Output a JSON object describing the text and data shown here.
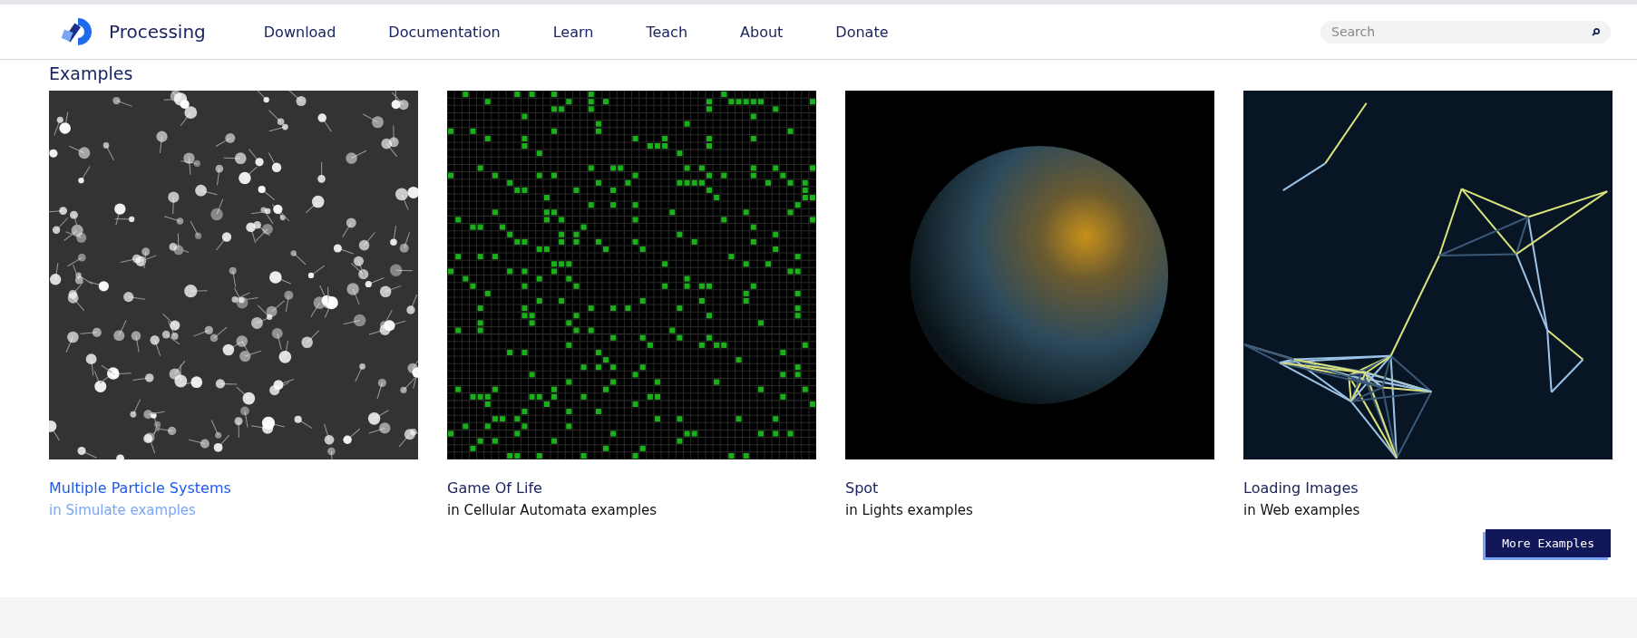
{
  "header": {
    "brand": "Processing",
    "nav": [
      "Download",
      "Documentation",
      "Learn",
      "Teach",
      "About",
      "Donate"
    ],
    "search": {
      "placeholder": "Search"
    }
  },
  "section": {
    "heading": "Examples"
  },
  "examples": [
    {
      "kind": "particles",
      "title": "Multiple Particle Systems",
      "category": "in Simulate examples",
      "hovered": true
    },
    {
      "kind": "life",
      "title": "Game Of Life",
      "category": "in Cellular Automata examples",
      "hovered": false
    },
    {
      "kind": "spot",
      "title": "Spot",
      "category": "in Lights examples",
      "hovered": false
    },
    {
      "kind": "web",
      "title": "Loading Images",
      "category": "in Web examples",
      "hovered": false
    }
  ],
  "more_button": "More Examples"
}
